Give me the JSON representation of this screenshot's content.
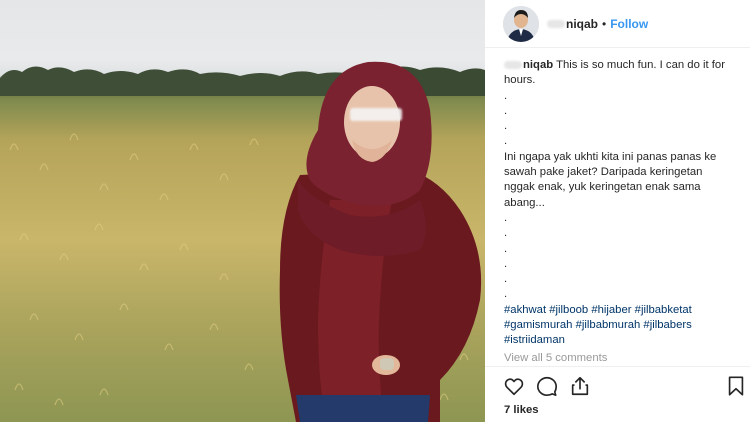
{
  "post": {
    "author": {
      "username": "niqab",
      "follow_label": "Follow",
      "separator": "•"
    },
    "caption": {
      "username": "niqab",
      "lines": [
        "This is so much fun. I can do it for hours.",
        ".",
        ".",
        ".",
        ".",
        "Ini ngapa yak ukhti kita ini panas panas ke sawah pake jaket? Daripada keringetan nggak enak, yuk keringetan enak sama abang...",
        ".",
        ".",
        ".",
        ".",
        ".",
        "."
      ],
      "hashtags": [
        "#akhwat",
        "#jilboob",
        "#hijaber",
        "#jilbabketat",
        "#gamismurah",
        "#jilbabmurah",
        "#jilbabers",
        "#istriidaman"
      ]
    },
    "view_all_comments": "View all 5 comments",
    "likes": "7 likes"
  },
  "icons": {
    "like": "heart-outline-icon",
    "comment": "speech-bubble-icon",
    "share": "share-upload-icon",
    "save": "bookmark-icon"
  },
  "colors": {
    "follow": "#3897f0",
    "hashtag": "#003569",
    "muted": "#999999",
    "text": "#262626"
  }
}
